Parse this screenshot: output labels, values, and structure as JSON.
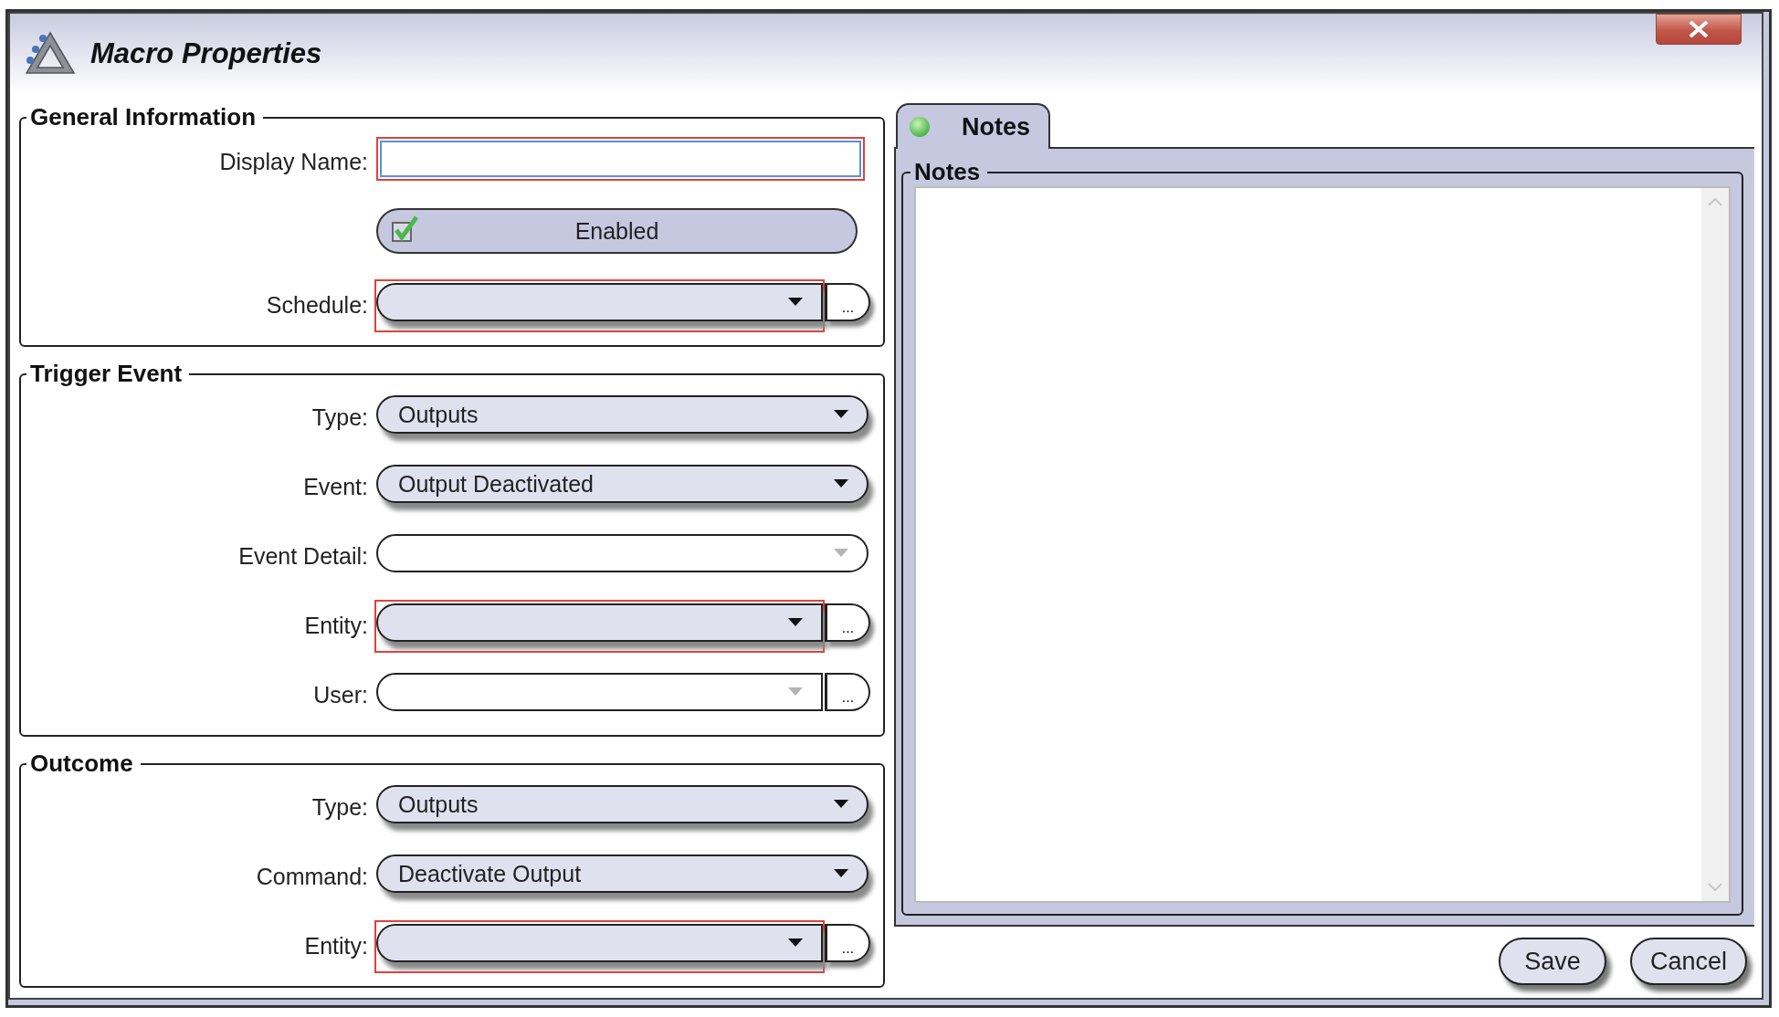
{
  "window": {
    "title": "Macro Properties"
  },
  "sections": [
    {
      "title": "General Information",
      "rows": [
        {
          "kind": "text",
          "label": "Display Name:",
          "required": true
        },
        {
          "kind": "toggle",
          "label": "Enabled",
          "checked": true
        },
        {
          "kind": "combo",
          "label": "Schedule:",
          "required": true,
          "disabled": false,
          "browse": "..."
        }
      ]
    },
    {
      "title": "Trigger Event",
      "rows": [
        {
          "kind": "combo",
          "label": "Type:",
          "value": "Outputs",
          "required": false,
          "disabled": false
        },
        {
          "kind": "combo",
          "label": "Event:",
          "value": "Output Deactivated",
          "required": false,
          "disabled": false
        },
        {
          "kind": "combo",
          "label": "Event Detail:",
          "required": false,
          "disabled": true
        },
        {
          "kind": "combo",
          "label": "Entity:",
          "required": true,
          "disabled": false,
          "browse": "..."
        },
        {
          "kind": "combo",
          "label": "User:",
          "required": false,
          "disabled": true,
          "browse": "..."
        }
      ]
    },
    {
      "title": "Outcome",
      "rows": [
        {
          "kind": "combo",
          "label": "Type:",
          "value": "Outputs",
          "required": false,
          "disabled": false
        },
        {
          "kind": "combo",
          "label": "Command:",
          "value": "Deactivate Output",
          "required": false,
          "disabled": false
        },
        {
          "kind": "combo",
          "label": "Entity:",
          "required": true,
          "disabled": false,
          "browse": "..."
        }
      ]
    }
  ],
  "tabs": [
    {
      "label": "Notes",
      "selected": true
    }
  ],
  "notes": {
    "title": "Notes"
  },
  "buttons": [
    "Save",
    "Cancel"
  ]
}
